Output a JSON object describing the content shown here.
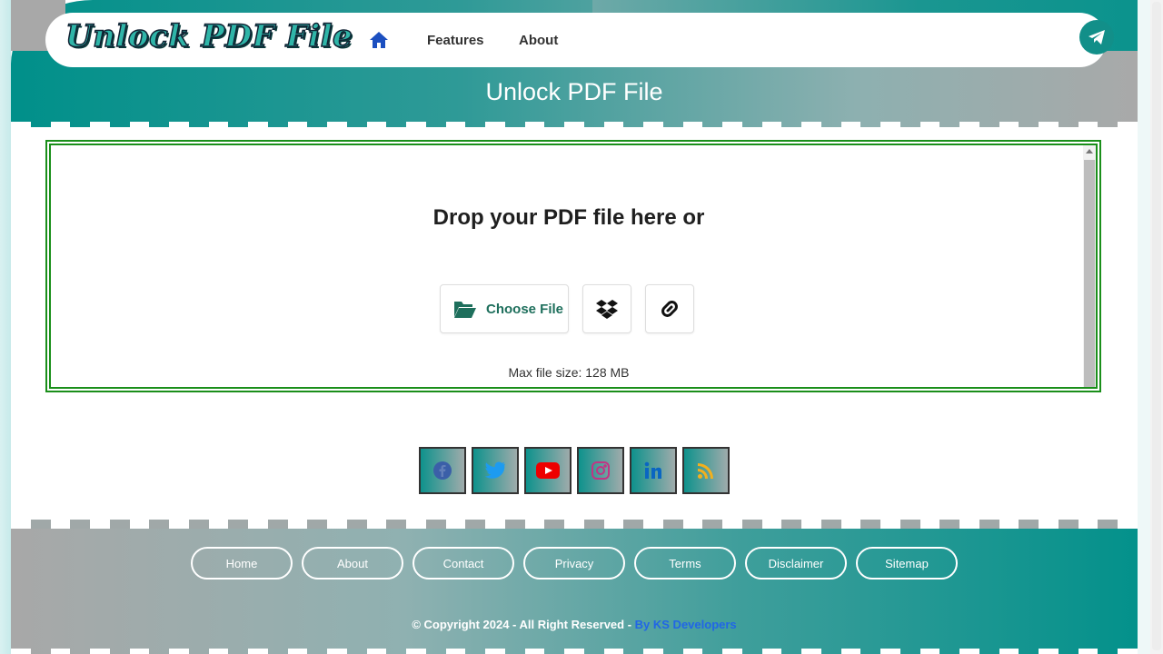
{
  "header": {
    "logo_text": "Unlock PDF File",
    "nav": [
      {
        "label": "Features"
      },
      {
        "label": "About"
      }
    ],
    "page_title": "Unlock PDF File"
  },
  "tool": {
    "drop_title": "Drop your PDF file here or",
    "choose_label": "Choose File",
    "max_size": "Max file size: 128 MB"
  },
  "social": [
    {
      "icon": "facebook-icon"
    },
    {
      "icon": "twitter-icon"
    },
    {
      "icon": "youtube-icon"
    },
    {
      "icon": "instagram-icon"
    },
    {
      "icon": "linkedin-icon"
    },
    {
      "icon": "rss-icon"
    }
  ],
  "footer": {
    "links": [
      "Home",
      "About",
      "Contact",
      "Privacy",
      "Terms",
      "Disclaimer",
      "Sitemap"
    ],
    "copyright": "© Copyright 2024 - All Right Reserved - ",
    "developer": "By KS Developers"
  },
  "colors": {
    "accent": "#00908a",
    "tool_border": "#1a8f1a",
    "gray": "#a8a8a8",
    "link_blue": "#2166e6"
  }
}
